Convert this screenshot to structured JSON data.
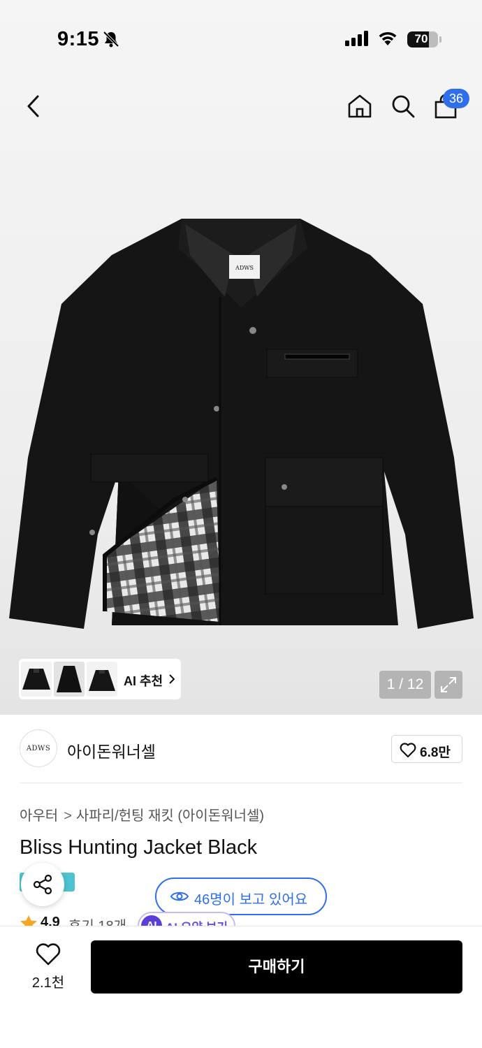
{
  "status_bar": {
    "time": "9:15",
    "battery": "70",
    "battery_level": 0.7
  },
  "header": {
    "cart_count": "36"
  },
  "gallery": {
    "ai_recommend_label": "AI 추천",
    "page_counter": "1 / 12",
    "jacket_label": "ADWS"
  },
  "brand": {
    "logo_text": "ADWS",
    "name": "아이돈워너셀",
    "like_count": "6.8만"
  },
  "product": {
    "breadcrumb": [
      "아우터",
      "사파리/헌팅 재킷 (아이돈워너셀)"
    ],
    "title": "Bliss Hunting Jacket Black",
    "rating": "4.9",
    "reviews": "후기 18개",
    "ai_summary_badge": "AI",
    "ai_summary_label": "AI 요약 보기"
  },
  "viewers": {
    "text": "46명이 보고 있어요"
  },
  "bottom_bar": {
    "wish_count": "2.1천",
    "buy_label": "구매하기"
  },
  "colors": {
    "accent": "#2f6fed",
    "ai_purple": "#5b3fd8",
    "buy_bg": "#000000",
    "tag": "#4ec3d1"
  }
}
